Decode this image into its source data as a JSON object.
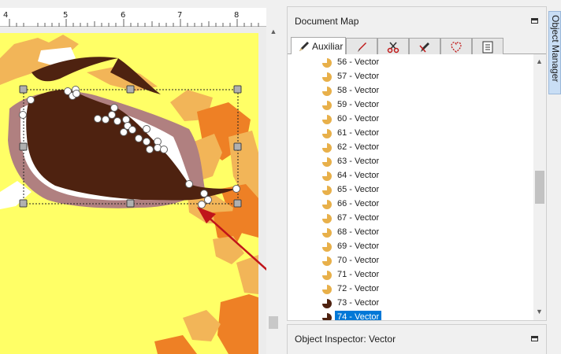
{
  "ruler": {
    "ticks": [
      "4",
      "5",
      "6",
      "7",
      "8"
    ]
  },
  "document_map": {
    "title": "Document Map",
    "tabs": [
      {
        "label": "Auxiliar",
        "icon": "pencil-icon",
        "active": true
      },
      {
        "label": "",
        "icon": "brush-icon",
        "active": false
      },
      {
        "label": "",
        "icon": "scissors-icon",
        "active": false
      },
      {
        "label": "",
        "icon": "pen-cut-icon",
        "active": false
      },
      {
        "label": "",
        "icon": "heart-shape-icon",
        "active": false
      },
      {
        "label": "",
        "icon": "list-icon",
        "active": false
      }
    ],
    "items": [
      {
        "label": "56 - Vector",
        "color": "#e8b04a"
      },
      {
        "label": "57 - Vector",
        "color": "#e8b04a"
      },
      {
        "label": "58 - Vector",
        "color": "#e8b04a"
      },
      {
        "label": "59 - Vector",
        "color": "#e8b04a"
      },
      {
        "label": "60 - Vector",
        "color": "#e8b04a"
      },
      {
        "label": "61 - Vector",
        "color": "#e8b04a"
      },
      {
        "label": "62 - Vector",
        "color": "#e8b04a"
      },
      {
        "label": "63 - Vector",
        "color": "#e8b04a"
      },
      {
        "label": "64 - Vector",
        "color": "#e8b04a"
      },
      {
        "label": "65 - Vector",
        "color": "#e8b04a"
      },
      {
        "label": "66 - Vector",
        "color": "#e8b04a"
      },
      {
        "label": "67 - Vector",
        "color": "#e8b04a"
      },
      {
        "label": "68 - Vector",
        "color": "#e8b04a"
      },
      {
        "label": "69 - Vector",
        "color": "#e8b04a"
      },
      {
        "label": "70 - Vector",
        "color": "#e8b04a"
      },
      {
        "label": "71 - Vector",
        "color": "#e8b04a"
      },
      {
        "label": "72 - Vector",
        "color": "#e8b04a"
      },
      {
        "label": "73 - Vector",
        "color": "#4e2210"
      },
      {
        "label": "74 - Vector",
        "color": "#4e2210",
        "selected": true
      }
    ]
  },
  "object_inspector": {
    "title": "Object Inspector: Vector"
  },
  "side_tab": {
    "label": "Object Manager"
  },
  "colors": {
    "canvas_yellow": "#ffff66",
    "dark_brown": "#4e2210",
    "mauve": "#b08080",
    "orange": "#ee8025",
    "light_orange": "#f2b558",
    "selection_blue": "#0078d7",
    "arrow_red": "#c0141a"
  }
}
